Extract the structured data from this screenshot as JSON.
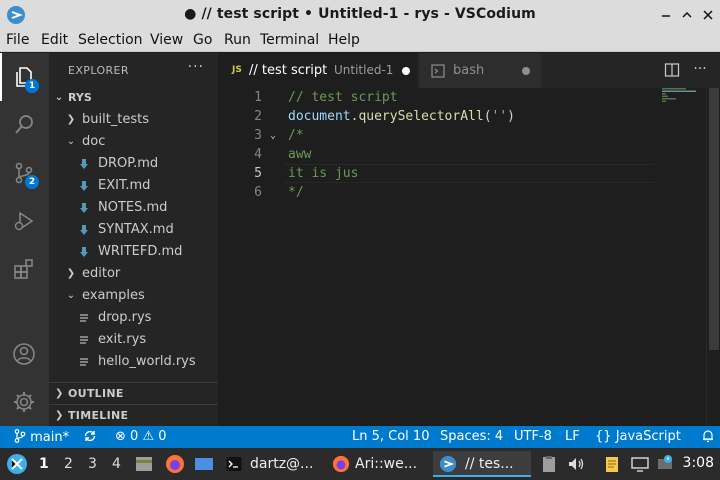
{
  "window": {
    "title": "● // test script • Untitled-1 - rys - VSCodium"
  },
  "menu": [
    "File",
    "Edit",
    "Selection",
    "View",
    "Go",
    "Run",
    "Terminal",
    "Help"
  ],
  "activity": {
    "explorer_badge": "1",
    "scm_badge": "2"
  },
  "sidebar": {
    "title": "EXPLORER",
    "more": "···",
    "root": "RYS",
    "tree": [
      {
        "label": "built_tests",
        "type": "folder",
        "open": false,
        "depth": 1
      },
      {
        "label": "doc",
        "type": "folder",
        "open": true,
        "depth": 1
      },
      {
        "label": "DROP.md",
        "type": "md",
        "depth": 2
      },
      {
        "label": "EXIT.md",
        "type": "md",
        "depth": 2
      },
      {
        "label": "NOTES.md",
        "type": "md",
        "depth": 2
      },
      {
        "label": "SYNTAX.md",
        "type": "md",
        "depth": 2
      },
      {
        "label": "WRITEFD.md",
        "type": "md",
        "depth": 2
      },
      {
        "label": "editor",
        "type": "folder",
        "open": false,
        "depth": 1
      },
      {
        "label": "examples",
        "type": "folder",
        "open": true,
        "depth": 1
      },
      {
        "label": "drop.rys",
        "type": "file",
        "depth": 2
      },
      {
        "label": "exit.rys",
        "type": "file",
        "depth": 2
      },
      {
        "label": "hello_world.rys",
        "type": "file",
        "depth": 2
      }
    ],
    "outline": "OUTLINE",
    "timeline": "TIMELINE"
  },
  "tabs": [
    {
      "icon": "JS",
      "name": "// test script",
      "desc": "Untitled-1",
      "modified": true,
      "active": true
    },
    {
      "icon": "terminal-icon",
      "name": "bash",
      "modified": true,
      "active": false
    }
  ],
  "editor": {
    "current_line": 5,
    "lines": [
      {
        "n": "1",
        "tokens": [
          {
            "t": "// test script",
            "c": "comment"
          }
        ]
      },
      {
        "n": "2",
        "tokens": [
          {
            "t": "document",
            "c": "ident"
          },
          {
            "t": ".",
            "c": "punc"
          },
          {
            "t": "querySelectorAll",
            "c": "func"
          },
          {
            "t": "(",
            "c": "punc"
          },
          {
            "t": "''",
            "c": "str"
          },
          {
            "t": ")",
            "c": "punc"
          }
        ]
      },
      {
        "n": "3",
        "fold": true,
        "tokens": [
          {
            "t": "/*",
            "c": "comment"
          }
        ]
      },
      {
        "n": "4",
        "tokens": [
          {
            "t": "aww",
            "c": "comment"
          }
        ]
      },
      {
        "n": "5",
        "tokens": [
          {
            "t": "it is jus",
            "c": "comment"
          }
        ]
      },
      {
        "n": "6",
        "tokens": [
          {
            "t": "*/",
            "c": "comment"
          }
        ]
      }
    ]
  },
  "status": {
    "branch": "main*",
    "errors": "0",
    "warnings": "0",
    "position": "Ln 5, Col 10",
    "spaces": "Spaces: 4",
    "encoding": "UTF-8",
    "eol": "LF",
    "language": "JavaScript",
    "language_prefix": "{}"
  },
  "taskbar": {
    "workspaces": [
      "1",
      "2",
      "3",
      "4"
    ],
    "active_workspace": "1",
    "tasks": [
      {
        "icon": "terminal-icon",
        "label": "dartz@..."
      },
      {
        "icon": "firefox-icon",
        "label": "Ari::we..."
      },
      {
        "icon": "vscodium-icon",
        "label": "// tes..."
      }
    ],
    "clock": "3:08"
  },
  "colors": {
    "statusbar": "#007acc",
    "badge": "#0078d4",
    "comment": "#6a9955",
    "md_icon": "#519aba"
  }
}
